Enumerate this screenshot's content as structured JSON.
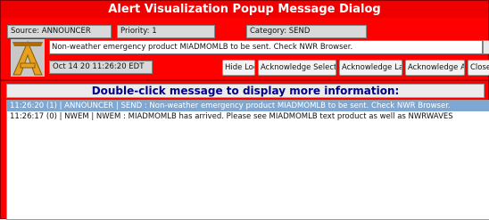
{
  "window": {
    "title": "Alert Visualization Popup Message Dialog"
  },
  "info": {
    "source": "Source: ANNOUNCER",
    "priority": "Priority: 1",
    "category": "Category: SEND"
  },
  "message": {
    "text": "Non-weather emergency product MIADMOMLB to be sent. Check NWR Browser."
  },
  "timestamp": {
    "text": "Oct 14 20 11:26:20 EDT"
  },
  "buttons": {
    "hide_log": "Hide Log",
    "ack_selected": "Acknowledge Selected",
    "ack_last": "Acknowledge Last",
    "ack_all": "Acknowledge All",
    "close": "Close"
  },
  "log": {
    "header": "Double-click message to display more information:",
    "rows": [
      "11:26:20 (1) | ANNOUNCER | SEND : Non-weather emergency product MIADMOMLB to be sent. Check NWR Browser.",
      "11:26:17 (0) | NWEM | NWEM : MIADMOMLB has arrived. Please see MIADMOMLB text product as well as NWRWAVES"
    ]
  },
  "colors": {
    "dialog_background": "#ff0000",
    "header_text": "#00008b",
    "selected_row": "#7ea7d3",
    "logo_primary": "#e8a020"
  },
  "icons": {
    "logo": "awips-a-logo"
  }
}
